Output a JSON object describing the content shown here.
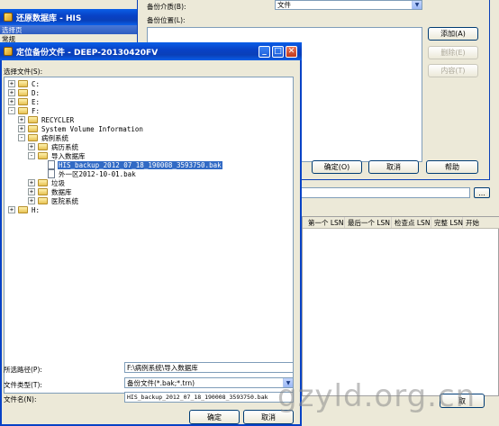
{
  "restore_window": {
    "title": "还原数据库 - HIS",
    "select_page_label": "选择页",
    "general_label": "常规",
    "col_headers": [
      "第一个 LSN",
      "最后一个 LSN",
      "检查点 LSN",
      "完整 LSN",
      "开始"
    ],
    "cancel_fragment": "取"
  },
  "backup_dialog": {
    "medium_label": "备份介质(B):",
    "medium_value": "文件",
    "location_label": "备份位置(L):",
    "add_button": "添加(A)",
    "remove_button": "删除(E)",
    "content_button": "内容(T)",
    "ok_button": "确定(O)",
    "cancel_button": "取消",
    "help_button": "帮助",
    "ellipsis_button": "..."
  },
  "locate_dialog": {
    "title": "定位备份文件 - DEEP-20130420FV",
    "select_file_label": "选择文件(S):",
    "tree": [
      {
        "label": "C:",
        "depth": 0,
        "expander": "+",
        "icon": "folder"
      },
      {
        "label": "D:",
        "depth": 0,
        "expander": "+",
        "icon": "folder"
      },
      {
        "label": "E:",
        "depth": 0,
        "expander": "+",
        "icon": "folder"
      },
      {
        "label": "F:",
        "depth": 0,
        "expander": "-",
        "icon": "folder"
      },
      {
        "label": "RECYCLER",
        "depth": 1,
        "expander": "+",
        "icon": "folder"
      },
      {
        "label": "System Volume Information",
        "depth": 1,
        "expander": "+",
        "icon": "folder"
      },
      {
        "label": "病例系统",
        "depth": 1,
        "expander": "-",
        "icon": "folder"
      },
      {
        "label": "病历系统",
        "depth": 2,
        "expander": "+",
        "icon": "folder"
      },
      {
        "label": "导入数据库",
        "depth": 2,
        "expander": "-",
        "icon": "folder"
      },
      {
        "label": "HIS_backup_2012_07_18_190008_3593750.bak",
        "depth": 3,
        "expander": "",
        "icon": "file",
        "selected": true
      },
      {
        "label": "外一区2012-10-01.bak",
        "depth": 3,
        "expander": "",
        "icon": "file"
      },
      {
        "label": "垃圾",
        "depth": 2,
        "expander": "+",
        "icon": "folder"
      },
      {
        "label": "数据库",
        "depth": 2,
        "expander": "+",
        "icon": "folder"
      },
      {
        "label": "医院系统",
        "depth": 2,
        "expander": "+",
        "icon": "folder"
      },
      {
        "label": "H:",
        "depth": 0,
        "expander": "+",
        "icon": "folder"
      }
    ],
    "path_label": "所选路径(P):",
    "path_value": "F:\\病例系统\\导入数据库",
    "type_label": "文件类型(T):",
    "type_value": "备份文件(*.bak;*.trn)",
    "name_label": "文件名(N):",
    "name_value": "HIS_backup_2012_07_18_190008_3593750.bak",
    "ok_button": "确定",
    "cancel_button": "取消"
  },
  "watermark": "gzyld.org.cn",
  "colors": {
    "xp_titlebar": "#0842c6",
    "dialog_face": "#ece9d8",
    "selection": "#316ac5",
    "field_border": "#7f9db9"
  }
}
